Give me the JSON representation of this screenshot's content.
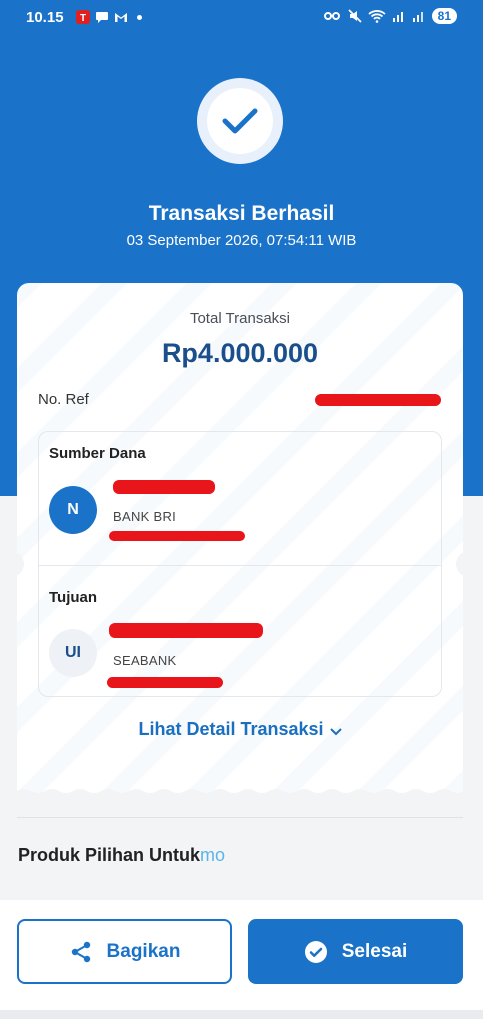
{
  "status_bar": {
    "time": "10.15",
    "battery": "81",
    "icons": [
      "telkomsel-icon",
      "chat-icon",
      "gmail-icon",
      "dot-icon",
      "vpn-key-icon",
      "mute-icon",
      "wifi-icon",
      "signal-icon",
      "signal-icon",
      "battery-icon"
    ]
  },
  "header": {
    "title": "Transaksi Berhasil",
    "datetime": "03 September 2026, 07:54:11 WIB",
    "icon": "check-icon"
  },
  "receipt": {
    "total_label": "Total Transaksi",
    "total_value": "Rp4.000.000",
    "ref_label": "No. Ref",
    "source": {
      "title": "Sumber Dana",
      "avatar": "N",
      "bank": "BANK BRI"
    },
    "destination": {
      "title": "Tujuan",
      "avatar": "UI",
      "bank": "SEABANK"
    },
    "detail_link": "Lihat Detail Transaksi"
  },
  "promo": {
    "title": "Produk Pilihan Untuk",
    "brand": "mo"
  },
  "actions": {
    "share_label": "Bagikan",
    "done_label": "Selesai"
  },
  "colors": {
    "primary": "#1a73c9",
    "redaction": "#e8151b",
    "amount": "#1a4f8c"
  }
}
